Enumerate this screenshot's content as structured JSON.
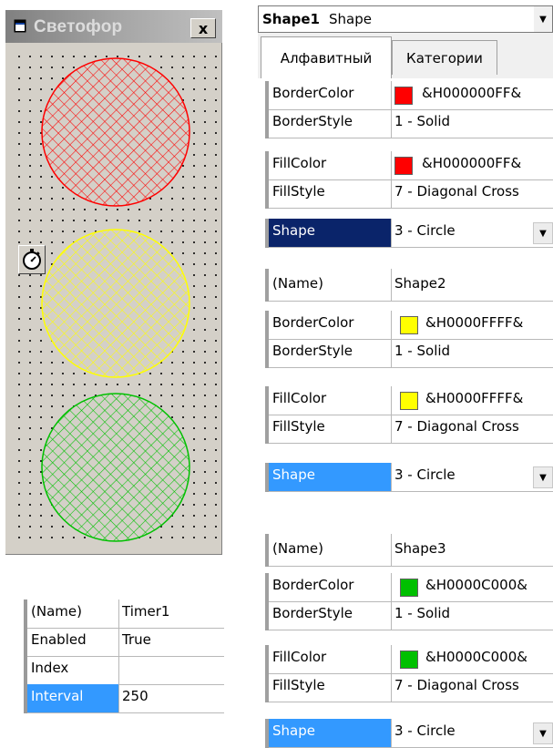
{
  "form": {
    "title": "Светофор",
    "close_label": "x",
    "lamps": [
      {
        "name": "red-lamp",
        "color": "#ff0000"
      },
      {
        "name": "yellow-lamp",
        "color": "#ffff00"
      },
      {
        "name": "green-lamp",
        "color": "#00c000"
      }
    ],
    "timer_icon": "stopwatch-icon"
  },
  "timer_props": {
    "rows": [
      {
        "name": "(Name)",
        "value": "Timer1"
      },
      {
        "name": "Enabled",
        "value": "True"
      },
      {
        "name": "Index",
        "value": ""
      },
      {
        "name": "Interval",
        "value": "250"
      }
    ],
    "selected": "Interval"
  },
  "object_combo": {
    "name": "Shape1",
    "type": "Shape"
  },
  "tabs": [
    "Алфавитный",
    "Категории"
  ],
  "active_tab": "Алфавитный",
  "shape1": {
    "border_color": {
      "name": "BorderColor",
      "value": "&H000000FF&",
      "swatch": "#ff0000"
    },
    "border_style": {
      "name": "BorderStyle",
      "value": "1 - Solid"
    },
    "fill_color": {
      "name": "FillColor",
      "value": "&H000000FF&",
      "swatch": "#ff0000"
    },
    "fill_style": {
      "name": "FillStyle",
      "value": "7 - Diagonal Cross"
    },
    "shape": {
      "name": "Shape",
      "value": "3 - Circle"
    }
  },
  "shape2": {
    "name_row": {
      "name": "(Name)",
      "value": "Shape2"
    },
    "border_color": {
      "name": "BorderColor",
      "value": "&H0000FFFF&",
      "swatch": "#ffff00"
    },
    "border_style": {
      "name": "BorderStyle",
      "value": "1 - Solid"
    },
    "fill_color": {
      "name": "FillColor",
      "value": "&H0000FFFF&",
      "swatch": "#ffff00"
    },
    "fill_style": {
      "name": "FillStyle",
      "value": "7 - Diagonal Cross"
    },
    "shape": {
      "name": "Shape",
      "value": "3 - Circle"
    }
  },
  "shape3": {
    "name_row": {
      "name": "(Name)",
      "value": "Shape3"
    },
    "border_color": {
      "name": "BorderColor",
      "value": "&H0000C000&",
      "swatch": "#00c000"
    },
    "border_style": {
      "name": "BorderStyle",
      "value": "1 - Solid"
    },
    "fill_color": {
      "name": "FillColor",
      "value": "&H0000C000&",
      "swatch": "#00c000"
    },
    "fill_style": {
      "name": "FillStyle",
      "value": "7 - Diagonal Cross"
    },
    "shape": {
      "name": "Shape",
      "value": "3 - Circle"
    }
  },
  "colors": {
    "selection_dark": "#0a246a",
    "selection_light": "#3399ff"
  }
}
